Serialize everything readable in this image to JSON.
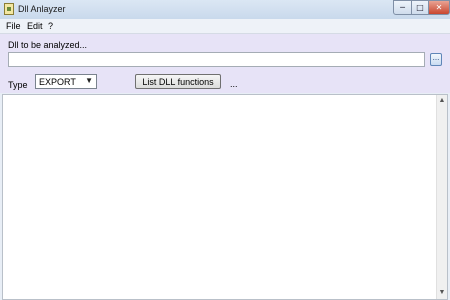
{
  "window": {
    "title": "Dll Anlayzer",
    "controls": {
      "minimize": "─",
      "maximize": "□",
      "close": "✕"
    }
  },
  "menu": {
    "file": "File",
    "edit": "Edit",
    "help": "?"
  },
  "form": {
    "dll_label": "Dll to be analyzed...",
    "dll_value": "",
    "browse_label": "...",
    "type_label": "Type",
    "type_value": "EXPORT",
    "list_button": "List DLL functions",
    "extra": "..."
  },
  "output": {
    "text": ""
  },
  "icons": {
    "app": "app-icon",
    "dropdown": "chevron-down-icon",
    "scroll_up": "scroll-up-icon",
    "scroll_down": "scroll-down-icon"
  }
}
